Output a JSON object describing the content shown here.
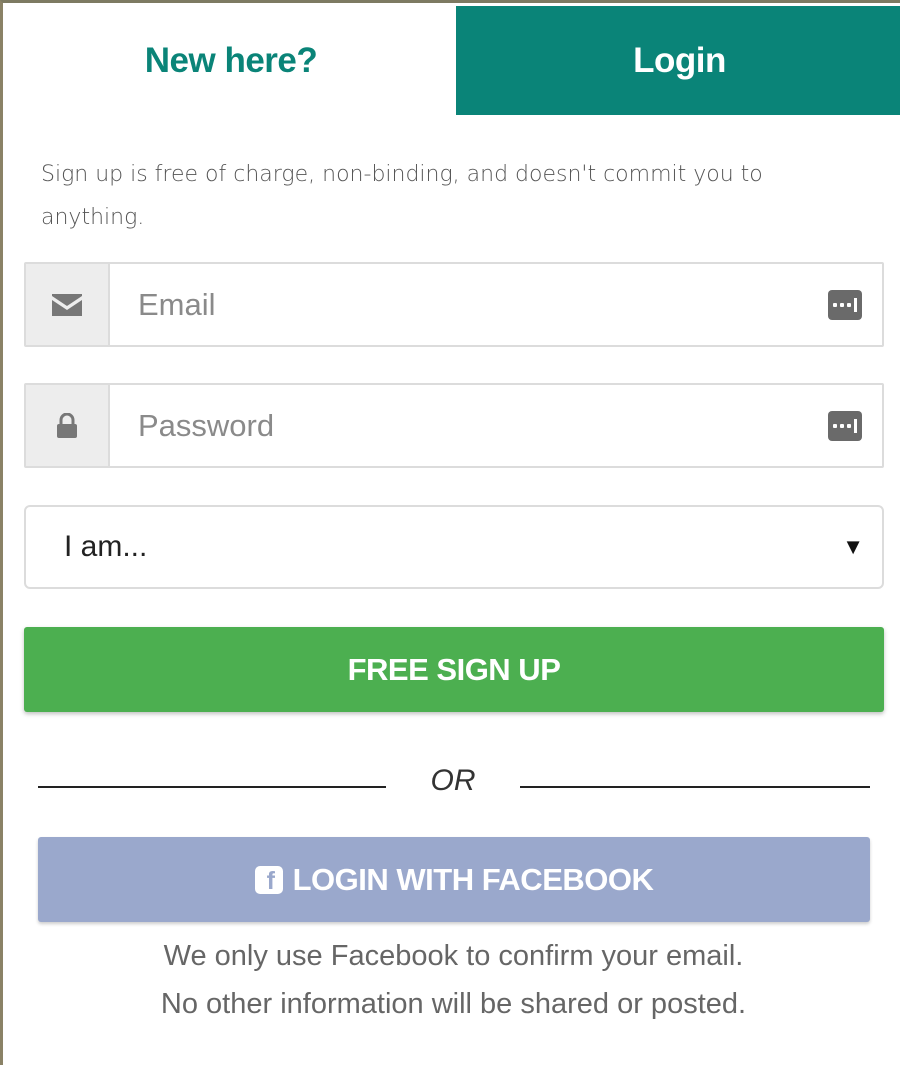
{
  "tabs": {
    "new_here": "New here?",
    "login": "Login"
  },
  "intro": "Sign up is free of charge, non-binding, and doesn't commit you to anything.",
  "form": {
    "email_placeholder": "Email",
    "email_value": "",
    "password_placeholder": "Password",
    "password_value": "",
    "role_select_value": "I am...",
    "role_select_caret": "▼",
    "signup_label": "FREE SIGN UP"
  },
  "divider_text": "OR",
  "facebook": {
    "button_label": "LOGIN WITH FACEBOOK",
    "note_line1": "We only use Facebook to confirm your email.",
    "note_line2": "No other information will be shared or posted."
  },
  "icons": {
    "email": "envelope-icon",
    "password": "lock-icon",
    "password_manager": "password-manager-icon",
    "facebook": "facebook-icon"
  },
  "colors": {
    "brand_teal": "#0a8478",
    "signup_green": "#4caf50",
    "facebook_button": "#9aa8cc",
    "addon_gray": "#ededed"
  }
}
